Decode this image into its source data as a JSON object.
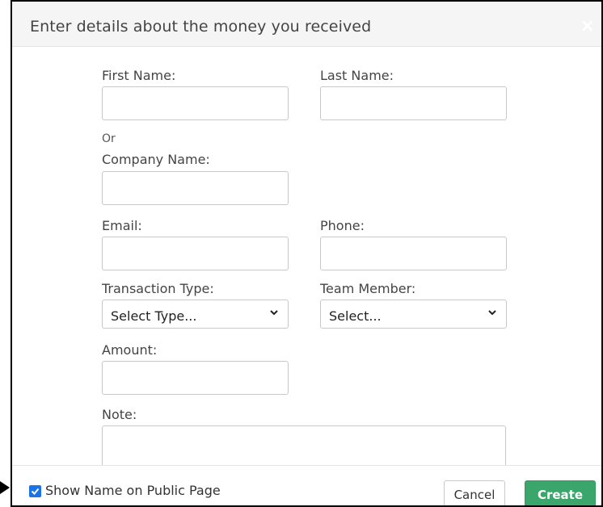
{
  "modal": {
    "title": "Enter details about the money you received",
    "close_icon": "close-icon"
  },
  "form": {
    "first_name": {
      "label": "First Name:",
      "value": "",
      "placeholder": ""
    },
    "last_name": {
      "label": "Last Name:",
      "value": "",
      "placeholder": ""
    },
    "or_text": "Or",
    "company_name": {
      "label": "Company Name:",
      "value": "",
      "placeholder": ""
    },
    "email": {
      "label": "Email:",
      "value": "",
      "placeholder": ""
    },
    "phone": {
      "label": "Phone:",
      "value": "",
      "placeholder": ""
    },
    "transaction_type": {
      "label": "Transaction Type:",
      "selected": "Select Type..."
    },
    "team_member": {
      "label": "Team Member:",
      "selected": "Select..."
    },
    "amount": {
      "label": "Amount:",
      "value": "",
      "placeholder": ""
    },
    "note": {
      "label": "Note:",
      "value": ""
    }
  },
  "footer": {
    "show_name_label": "Show Name on Public Page",
    "show_name_checked": true,
    "cancel_label": "Cancel",
    "create_label": "Create"
  },
  "colors": {
    "header_bg": "#f5f5f5",
    "checkbox_accent": "#1a73e8",
    "create_button": "#3aa66c",
    "text": "#444444"
  },
  "icons": {
    "chevron": "chevron-down-icon",
    "checkbox": "checkbox-checked-icon",
    "pointer": "arrow-right-icon"
  }
}
